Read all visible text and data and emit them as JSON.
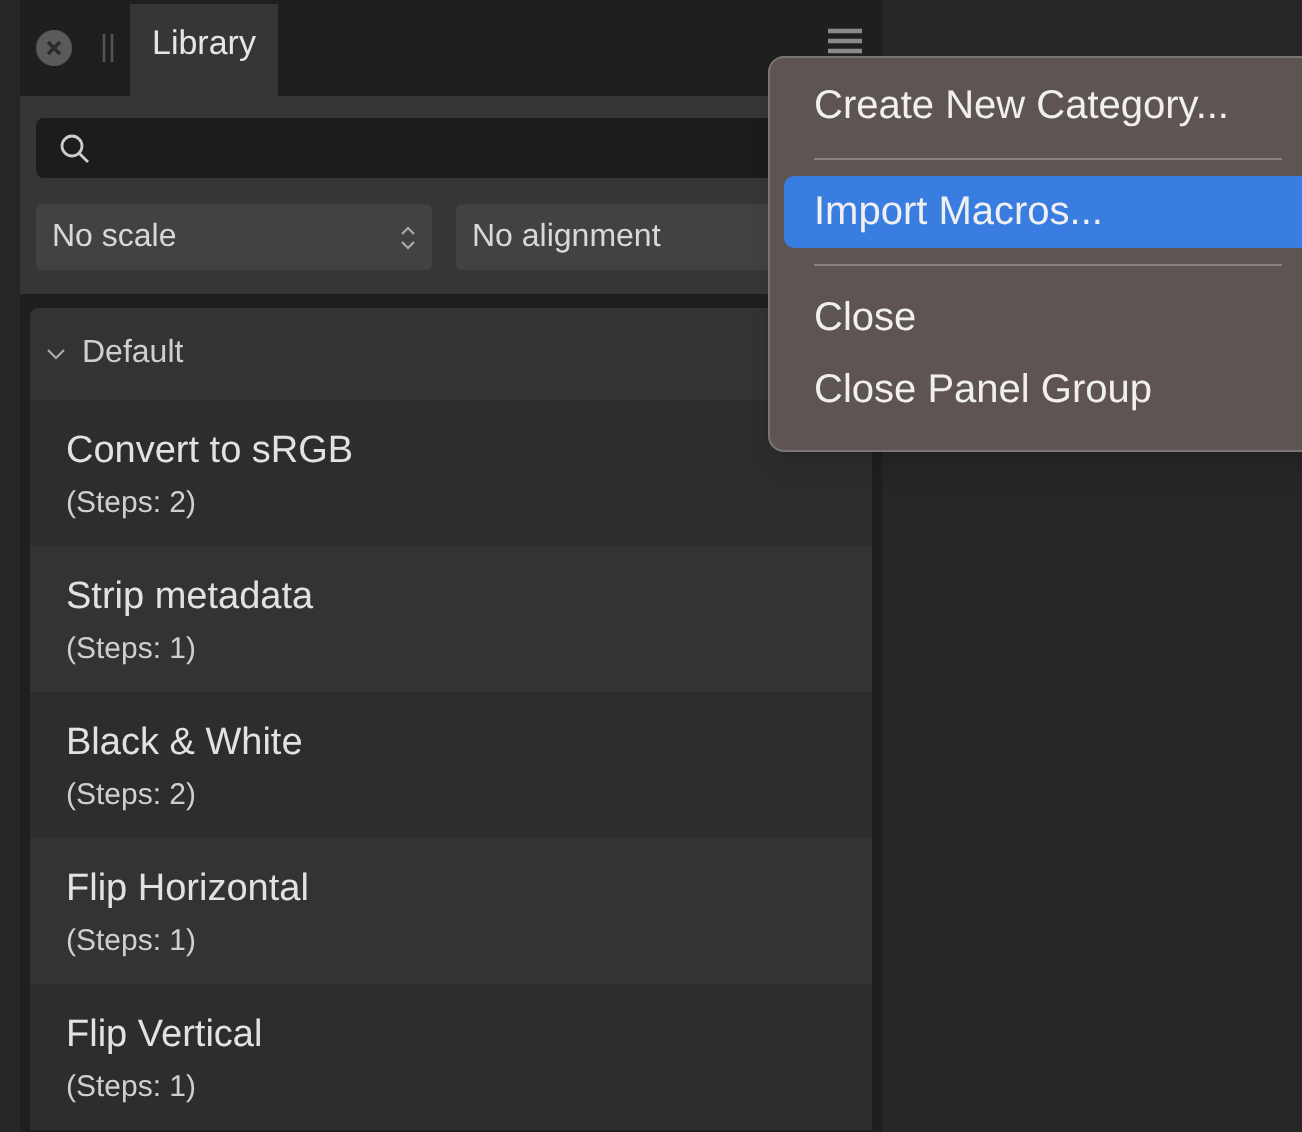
{
  "panel": {
    "tab": {
      "label": "Library",
      "selected": true
    },
    "scale_select": {
      "value": "No scale"
    },
    "alignment_select": {
      "value": "No alignment"
    }
  },
  "category": {
    "label": "Default",
    "expanded": true
  },
  "macros": [
    {
      "name": "Convert to sRGB",
      "steps": "(Steps: 2)"
    },
    {
      "name": "Strip metadata",
      "steps": "(Steps: 1)"
    },
    {
      "name": "Black & White",
      "steps": "(Steps: 2)"
    },
    {
      "name": "Flip Horizontal",
      "steps": "(Steps: 1)"
    },
    {
      "name": "Flip Vertical",
      "steps": "(Steps: 1)"
    }
  ],
  "menu": [
    {
      "kind": "item",
      "label": "Create New Category...",
      "selected": false
    },
    {
      "kind": "separator"
    },
    {
      "kind": "item",
      "label": "Import Macros...",
      "selected": true
    },
    {
      "kind": "separator"
    },
    {
      "kind": "item",
      "label": "Close",
      "selected": false
    },
    {
      "kind": "item",
      "label": "Close Panel Group",
      "selected": false
    }
  ]
}
